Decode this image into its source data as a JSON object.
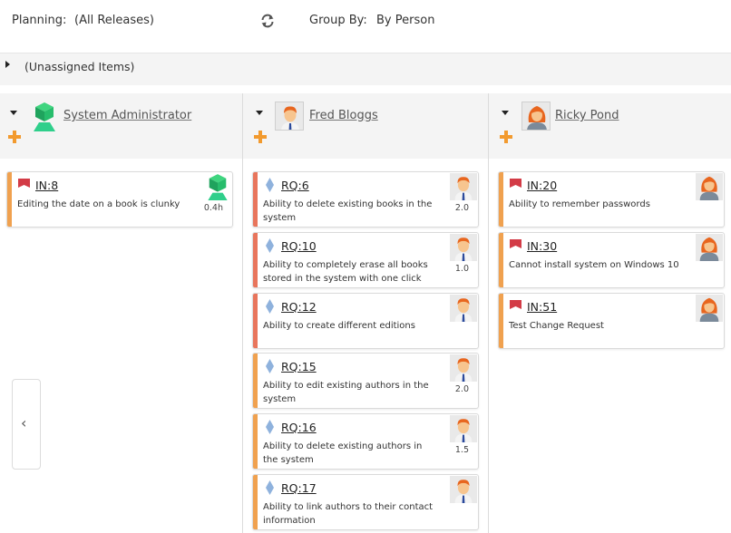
{
  "toolbar": {
    "planning_label": "Planning:",
    "planning_value": "(All Releases)",
    "group_label": "Group By:",
    "group_value": "By Person"
  },
  "unassigned": {
    "label": "(Unassigned Items)"
  },
  "columns": [
    {
      "person": "System Administrator",
      "avatar": "admin-cube-icon",
      "cards": [
        {
          "id": "IN:8",
          "type": "incident",
          "text": "Editing the date on a book is clunky",
          "estimate": "0.4h",
          "color": "#f0a14f",
          "avatar": "admin-cube-icon"
        }
      ]
    },
    {
      "person": "Fred Bloggs",
      "avatar": "man-avatar-icon",
      "cards": [
        {
          "id": "RQ:6",
          "type": "requirement",
          "text": "Ability to delete existing books in the system",
          "estimate": "2.0",
          "color": "#e8755c",
          "avatar": "man-avatar-icon"
        },
        {
          "id": "RQ:10",
          "type": "requirement",
          "text": "Ability to completely erase all books stored in the system with one click",
          "estimate": "1.0",
          "color": "#e8755c",
          "avatar": "man-avatar-icon"
        },
        {
          "id": "RQ:12",
          "type": "requirement",
          "text": "Ability to create different editions",
          "estimate": "",
          "color": "#e8755c",
          "avatar": "man-avatar-icon"
        },
        {
          "id": "RQ:15",
          "type": "requirement",
          "text": "Ability to edit existing authors in the system",
          "estimate": "2.0",
          "color": "#f0a14f",
          "avatar": "man-avatar-icon"
        },
        {
          "id": "RQ:16",
          "type": "requirement",
          "text": "Ability to delete existing authors in the system",
          "estimate": "1.5",
          "color": "#f0a14f",
          "avatar": "man-avatar-icon"
        },
        {
          "id": "RQ:17",
          "type": "requirement",
          "text": "Ability to link authors to their contact information",
          "estimate": "",
          "color": "#f0a14f",
          "avatar": "man-avatar-icon"
        }
      ]
    },
    {
      "person": "Ricky Pond",
      "avatar": "woman-avatar-icon",
      "cards": [
        {
          "id": "IN:20",
          "type": "incident",
          "text": "Ability to remember passwords",
          "estimate": "",
          "color": "#f0a14f",
          "avatar": "woman-avatar-icon"
        },
        {
          "id": "IN:30",
          "type": "incident",
          "text": "Cannot install system on Windows 10",
          "estimate": "",
          "color": "#f0a14f",
          "avatar": "woman-avatar-icon"
        },
        {
          "id": "IN:51",
          "type": "incident",
          "text": "Test Change Request",
          "estimate": "",
          "color": "#f0a14f",
          "avatar": "woman-avatar-icon"
        }
      ]
    }
  ],
  "back_button": {
    "glyph": "‹"
  }
}
